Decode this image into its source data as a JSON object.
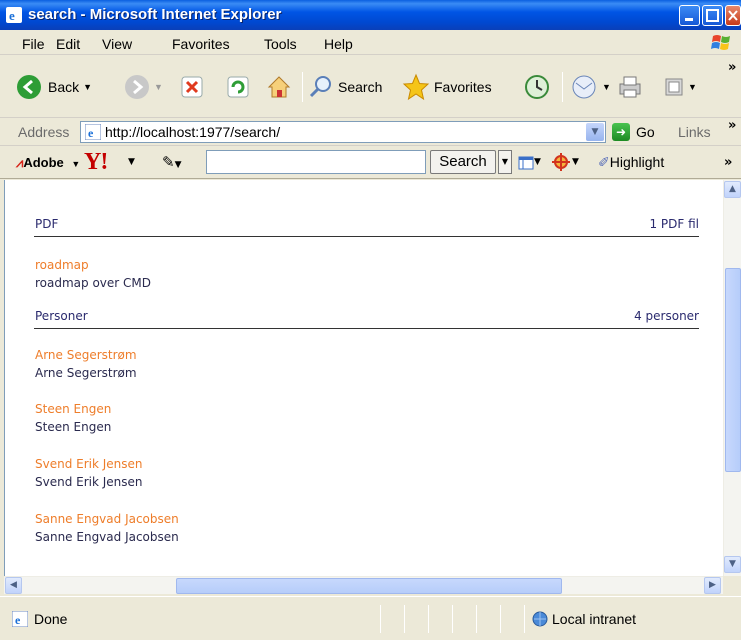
{
  "window": {
    "title": "search - Microsoft Internet Explorer"
  },
  "menu": {
    "items": [
      "File",
      "Edit",
      "View",
      "Favorites",
      "Tools",
      "Help"
    ]
  },
  "toolbar": {
    "back": "Back",
    "search": "Search",
    "favorites": "Favorites",
    "more": "»"
  },
  "address": {
    "label": "Address",
    "url": "http://localhost:1977/search/",
    "go": "Go",
    "links": "Links",
    "more": "»"
  },
  "yahoo_toolbar": {
    "adobe": "Adobe",
    "yahoo": "Y!",
    "search_value": "",
    "search_button": "Search",
    "highlight": "Highlight",
    "more": "»"
  },
  "content": {
    "sections": [
      {
        "title": "PDF",
        "count": "1 PDF fil",
        "results": [
          {
            "link": "roadmap",
            "desc": "roadmap over CMD"
          }
        ]
      },
      {
        "title": "Personer",
        "count": "4 personer",
        "results": [
          {
            "link": "Arne Segerstrøm",
            "desc": "Arne Segerstrøm"
          },
          {
            "link": "Steen Engen",
            "desc": "Steen Engen"
          },
          {
            "link": "Svend Erik Jensen",
            "desc": "Svend Erik Jensen"
          },
          {
            "link": "Sanne Engvad Jacobsen",
            "desc": "Sanne Engvad Jacobsen"
          }
        ]
      }
    ]
  },
  "status": {
    "text": "Done",
    "zone": "Local intranet"
  },
  "colors": {
    "link": "#ee7d2a",
    "titlebar": "#0055e5",
    "chrome": "#ece9d8"
  }
}
